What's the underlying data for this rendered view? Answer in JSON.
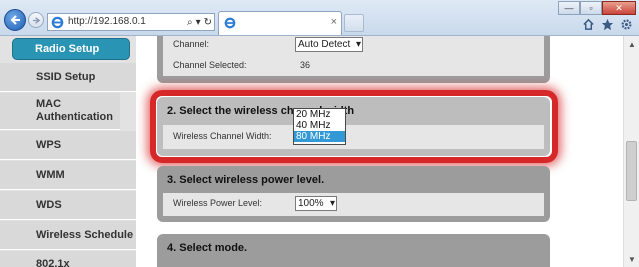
{
  "browser": {
    "address_url": "http://192.168.0.1",
    "search_glyph": "⌕",
    "dropdown_glyph": "▾",
    "refresh_glyph": "↻",
    "tab_title": "",
    "tab_close": "×",
    "win_min": "—",
    "win_max": "▫",
    "win_close": "✕",
    "home_icon": "home-icon",
    "star_icon": "star-icon",
    "gear_icon": "gear-icon"
  },
  "sidebar": {
    "items": [
      {
        "label": "Radio Setup"
      },
      {
        "label": "SSID Setup"
      },
      {
        "label": "MAC Authentication"
      },
      {
        "label": "WPS"
      },
      {
        "label": "WMM"
      },
      {
        "label": "WDS"
      },
      {
        "label": "Wireless Schedule"
      },
      {
        "label": "802.1x"
      }
    ]
  },
  "channel_section": {
    "channel_label": "Channel:",
    "channel_value": "Auto Detect",
    "channel_selected_label": "Channel Selected:",
    "channel_selected_value": "36"
  },
  "width_section": {
    "heading": "2. Select the wireless channel width",
    "width_label": "Wireless Channel Width:",
    "options": [
      "20 MHz",
      "40 MHz",
      "80 MHz"
    ],
    "selected": "80 MHz"
  },
  "power_section": {
    "heading": "3. Select wireless power level.",
    "power_label": "Wireless Power Level:",
    "power_value": "100%"
  },
  "mode_section": {
    "heading": "4. Select mode."
  },
  "colors": {
    "accent": "#2a94b5",
    "highlight": "#d62828",
    "selected_option": "#3399d6"
  }
}
